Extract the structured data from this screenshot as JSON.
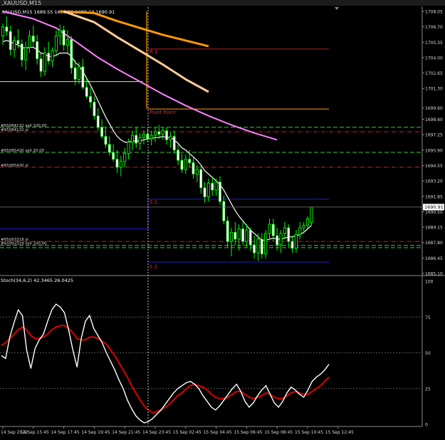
{
  "window": {
    "title_bar": ",XAUUSD,M15",
    "info_line": "XAUUSD,M15  1689.55 1690.91 1689.23 1690.91"
  },
  "colors": {
    "bull": "#00ff00",
    "bull_hollow_fill": "#000000",
    "bear_body": "#ffffff",
    "ma_fast": "#ffffff",
    "ma_mid": "#ff80ff",
    "ma_slow": "#ffcc99",
    "ma_slowest": "#ff9900",
    "pivot": "#ff9900",
    "resistance": "#b22222",
    "support": "#1e1ecc",
    "stoch_main": "#ffffff",
    "stoch_signal": "#dd0000",
    "grid": "#707070"
  },
  "main_chart": {
    "price_axis": {
      "min": 1685.1,
      "max": 1708.05,
      "ticks": [
        "1708.05",
        "1706.70",
        "1705.35",
        "1704.00",
        "1702.65",
        "1701.30",
        "1699.60",
        "1698.60",
        "1697.25",
        "1695.90",
        "1694.55",
        "1693.20",
        "1691.85",
        "1690.50",
        "1689.15",
        "1687.80",
        "1686.45",
        "1685.10"
      ],
      "current_price_label": "1690.91",
      "current_price": 1690.91
    },
    "levels": {
      "r1": {
        "label": "R 1",
        "price": 1704.75
      },
      "pivot": {
        "label": "Pivot Point",
        "price": 1699.5
      },
      "s1": {
        "label": "S 1",
        "price": 1691.6
      },
      "s2": {
        "label": "S 2",
        "price": 1686.1
      },
      "prev_pivot_yellow": {
        "price": 1701.9
      },
      "prev_s1_blue": {
        "price": 1689.0
      }
    },
    "order_lines": [
      {
        "label": "#65084132 sell 100.00",
        "price": 1697.9,
        "color": "#33cc33",
        "style": "dash"
      },
      {
        "label": "#65084132 sl",
        "price": 1697.5,
        "color": "#cc2222",
        "style": "dashdot"
      },
      {
        "label": "#65085430 sell 20.00",
        "price": 1695.7,
        "color": "#33cc33",
        "style": "dash"
      },
      {
        "label": "#65085430 sl",
        "price": 1694.4,
        "color": "#cc2222",
        "style": "dashdot"
      },
      {
        "label": "#65093318 sl",
        "price": 1687.9,
        "color": "#cc2222",
        "style": "dashdot"
      },
      {
        "label": "#65093318 sell 100.00",
        "price": 1687.55,
        "color": "#33cc33",
        "style": "dash"
      },
      {
        "label": "",
        "price": 1687.35,
        "color": "#33cc33",
        "style": "dash"
      }
    ],
    "ohlc": [
      [
        1705.9,
        1707.0,
        1705.1,
        1706.7
      ],
      [
        1706.7,
        1707.6,
        1705.9,
        1706.3
      ],
      [
        1706.3,
        1706.8,
        1704.2,
        1704.7
      ],
      [
        1704.7,
        1705.9,
        1704.0,
        1705.5
      ],
      [
        1705.5,
        1706.5,
        1704.8,
        1705.2
      ],
      [
        1705.2,
        1705.6,
        1703.2,
        1703.8
      ],
      [
        1703.8,
        1705.4,
        1702.9,
        1704.9
      ],
      [
        1704.9,
        1706.4,
        1704.4,
        1705.9
      ],
      [
        1705.9,
        1706.8,
        1704.9,
        1705.4
      ],
      [
        1705.4,
        1706.0,
        1703.4,
        1703.9
      ],
      [
        1703.9,
        1704.4,
        1702.3,
        1702.8
      ],
      [
        1702.8,
        1704.9,
        1702.4,
        1704.4
      ],
      [
        1704.4,
        1705.4,
        1703.4,
        1703.7
      ],
      [
        1703.7,
        1704.9,
        1703.2,
        1704.6
      ],
      [
        1704.6,
        1706.4,
        1704.1,
        1705.9
      ],
      [
        1705.9,
        1706.9,
        1705.1,
        1706.4
      ],
      [
        1706.4,
        1706.8,
        1704.6,
        1705.1
      ],
      [
        1705.1,
        1706.4,
        1704.4,
        1705.6
      ],
      [
        1705.6,
        1705.9,
        1702.6,
        1703.1
      ],
      [
        1703.1,
        1703.8,
        1701.6,
        1702.1
      ],
      [
        1702.1,
        1703.6,
        1701.7,
        1703.2
      ],
      [
        1703.2,
        1703.9,
        1701.2,
        1701.4
      ],
      [
        1701.4,
        1702.2,
        1700.4,
        1700.6
      ],
      [
        1700.6,
        1701.4,
        1699.6,
        1700.1
      ],
      [
        1700.1,
        1700.6,
        1698.6,
        1698.9
      ],
      [
        1698.9,
        1699.6,
        1697.6,
        1697.9
      ],
      [
        1697.9,
        1698.6,
        1696.9,
        1697.1
      ],
      [
        1697.1,
        1697.9,
        1696.1,
        1696.4
      ],
      [
        1696.4,
        1697.1,
        1695.4,
        1695.7
      ],
      [
        1695.7,
        1696.4,
        1694.9,
        1695.1
      ],
      [
        1695.1,
        1695.9,
        1693.9,
        1694.4
      ],
      [
        1694.4,
        1695.4,
        1693.6,
        1694.9
      ],
      [
        1694.9,
        1696.1,
        1694.4,
        1695.6
      ],
      [
        1695.6,
        1696.9,
        1695.1,
        1696.6
      ],
      [
        1696.6,
        1697.6,
        1695.9,
        1697.2
      ],
      [
        1697.2,
        1697.9,
        1696.1,
        1696.5
      ],
      [
        1696.5,
        1697.4,
        1695.9,
        1697.0
      ],
      [
        1697.0,
        1697.6,
        1696.4,
        1697.3
      ],
      [
        1697.3,
        1697.8,
        1696.6,
        1696.9
      ],
      [
        1696.9,
        1697.6,
        1696.3,
        1697.2
      ],
      [
        1697.2,
        1697.9,
        1696.6,
        1697.5
      ],
      [
        1697.5,
        1698.1,
        1696.9,
        1697.3
      ],
      [
        1697.3,
        1697.9,
        1696.8,
        1697.6
      ],
      [
        1697.6,
        1697.9,
        1696.4,
        1696.8
      ],
      [
        1696.8,
        1697.5,
        1696.1,
        1697.1
      ],
      [
        1697.1,
        1697.6,
        1695.6,
        1695.9
      ],
      [
        1695.9,
        1696.4,
        1694.6,
        1695.0
      ],
      [
        1695.0,
        1695.6,
        1693.9,
        1694.2
      ],
      [
        1694.2,
        1695.5,
        1693.8,
        1695.1
      ],
      [
        1695.1,
        1695.9,
        1694.4,
        1694.8
      ],
      [
        1694.8,
        1695.3,
        1693.4,
        1693.8
      ],
      [
        1693.8,
        1694.6,
        1693.1,
        1694.2
      ],
      [
        1694.2,
        1694.6,
        1692.1,
        1692.6
      ],
      [
        1692.6,
        1693.1,
        1691.3,
        1691.8
      ],
      [
        1691.8,
        1693.4,
        1691.4,
        1693.0
      ],
      [
        1693.0,
        1693.6,
        1691.9,
        1692.4
      ],
      [
        1692.4,
        1693.4,
        1691.9,
        1693.1
      ],
      [
        1693.1,
        1693.6,
        1691.1,
        1691.4
      ],
      [
        1691.4,
        1691.9,
        1689.4,
        1689.7
      ],
      [
        1689.7,
        1690.1,
        1687.4,
        1687.9
      ],
      [
        1687.9,
        1689.1,
        1686.6,
        1688.7
      ],
      [
        1688.7,
        1689.6,
        1687.6,
        1688.1
      ],
      [
        1688.1,
        1689.4,
        1687.1,
        1689.0
      ],
      [
        1689.0,
        1689.6,
        1687.6,
        1687.9
      ],
      [
        1687.9,
        1689.4,
        1687.4,
        1688.9
      ],
      [
        1688.9,
        1689.1,
        1687.1,
        1687.6
      ],
      [
        1687.6,
        1688.4,
        1686.4,
        1686.9
      ],
      [
        1686.9,
        1688.6,
        1686.2,
        1688.1
      ],
      [
        1688.1,
        1688.6,
        1686.4,
        1686.8
      ],
      [
        1686.8,
        1688.9,
        1686.4,
        1688.6
      ],
      [
        1688.6,
        1689.9,
        1688.1,
        1689.4
      ],
      [
        1689.4,
        1689.9,
        1687.9,
        1688.4
      ],
      [
        1688.4,
        1689.1,
        1687.1,
        1687.6
      ],
      [
        1687.6,
        1688.9,
        1686.9,
        1688.6
      ],
      [
        1688.6,
        1689.6,
        1688.1,
        1689.1
      ],
      [
        1689.1,
        1689.4,
        1687.4,
        1687.9
      ],
      [
        1687.9,
        1688.4,
        1686.9,
        1687.3
      ],
      [
        1687.3,
        1688.9,
        1686.9,
        1688.5
      ],
      [
        1688.5,
        1689.6,
        1688.1,
        1689.1
      ],
      [
        1689.1,
        1689.6,
        1688.6,
        1689.3
      ],
      [
        1689.3,
        1690.1,
        1688.9,
        1689.9
      ],
      [
        1689.55,
        1690.91,
        1689.23,
        1690.91
      ]
    ],
    "ma_fast": [
      1705.4,
      1705.5,
      1705.4,
      1705.2,
      1705.1,
      1704.9,
      1704.8,
      1704.9,
      1704.9,
      1704.7,
      1704.4,
      1704.3,
      1704.1,
      1704.1,
      1704.2,
      1704.4,
      1704.4,
      1704.4,
      1704.1,
      1703.6,
      1703.3,
      1702.8,
      1702.2,
      1701.6,
      1700.9,
      1700.2,
      1699.5,
      1698.8,
      1698.2,
      1697.6,
      1697.1,
      1696.8,
      1696.6,
      1696.6,
      1696.7,
      1696.7,
      1696.7,
      1696.8,
      1696.9,
      1696.9,
      1697.0,
      1697.0,
      1697.1,
      1697.0,
      1697.0,
      1696.8,
      1696.5,
      1696.1,
      1695.9,
      1695.6,
      1695.3,
      1695.0,
      1694.6,
      1694.1,
      1693.8,
      1693.5,
      1693.2,
      1692.9,
      1692.4,
      1691.8,
      1691.2,
      1690.6,
      1690.1,
      1689.7,
      1689.3,
      1688.9,
      1688.6,
      1688.3,
      1688.0,
      1688.0,
      1688.1,
      1688.2,
      1688.1,
      1688.1,
      1688.2,
      1688.3,
      1688.3,
      1688.4,
      1688.5,
      1688.7,
      1689.0,
      1689.3
    ],
    "ma_mid_line": [
      [
        0,
        1708.05
      ],
      [
        8,
        1707.4
      ],
      [
        14,
        1706.6
      ],
      [
        20,
        1705.2
      ],
      [
        25,
        1704.0
      ],
      [
        30,
        1703.0
      ],
      [
        36,
        1701.9
      ],
      [
        42,
        1700.8
      ],
      [
        48,
        1699.8
      ],
      [
        54,
        1698.9
      ],
      [
        60,
        1698.1
      ],
      [
        66,
        1697.4
      ],
      [
        72,
        1696.8
      ]
    ],
    "ma_slow_line": [
      [
        16,
        1708.05
      ],
      [
        24,
        1707.1
      ],
      [
        30,
        1705.8
      ],
      [
        36,
        1704.6
      ],
      [
        42,
        1703.4
      ],
      [
        48,
        1702.1
      ],
      [
        54,
        1701.0
      ]
    ],
    "ma_slowest_line": [
      [
        15,
        1708.05
      ],
      [
        24,
        1707.9
      ],
      [
        30,
        1707.2
      ],
      [
        36,
        1706.6
      ],
      [
        42,
        1706.0
      ],
      [
        48,
        1705.5
      ],
      [
        54,
        1705.0
      ]
    ]
  },
  "oscillator": {
    "label": "Stoch(34,6,2) 42.3465 26.0425",
    "ticks": [
      "100",
      "75",
      "50",
      "25",
      "0"
    ],
    "main": [
      48,
      46,
      61,
      71,
      80,
      76,
      52,
      39,
      53,
      59,
      63,
      72,
      80,
      84,
      82,
      78,
      66,
      52,
      40,
      60,
      72,
      76,
      67,
      62,
      57,
      50,
      44,
      38,
      31,
      25,
      17,
      11,
      6,
      3,
      1,
      2,
      4,
      7,
      10,
      14,
      18,
      22,
      25,
      27,
      29,
      30,
      28,
      25,
      20,
      16,
      12,
      10,
      13,
      17,
      21,
      25,
      28,
      23,
      16,
      12,
      15,
      20,
      24,
      27,
      21,
      15,
      12,
      16,
      22,
      26,
      24,
      21,
      19,
      24,
      30,
      33,
      35,
      38,
      42
    ],
    "signal": [
      55,
      57,
      60,
      63,
      66,
      68,
      66,
      62,
      60,
      60,
      61,
      63,
      66,
      68,
      69,
      69,
      67,
      64,
      60,
      59,
      59,
      61,
      61,
      60,
      58,
      56,
      52,
      48,
      43,
      38,
      33,
      27,
      22,
      17,
      13,
      10,
      8,
      9,
      10,
      12,
      14,
      17,
      20,
      22,
      25,
      27,
      28,
      27,
      26,
      24,
      21,
      19,
      18,
      18,
      19,
      21,
      23,
      23,
      21,
      19,
      18,
      19,
      20,
      22,
      21,
      19,
      18,
      18,
      20,
      22,
      23,
      22,
      21,
      21,
      23,
      25,
      27,
      30,
      33
    ]
  },
  "time_axis": {
    "labels": [
      {
        "text": "14 Sep 2022",
        "bar": 0
      },
      {
        "text": "14 Sep 15:45",
        "bar": 8
      },
      {
        "text": "14 Sep 17:45",
        "bar": 16
      },
      {
        "text": "14 Sep 19:45",
        "bar": 24
      },
      {
        "text": "14 Sep 21:45",
        "bar": 32
      },
      {
        "text": "14 Sep 23:45",
        "bar": 40
      },
      {
        "text": "15 Sep 02:45",
        "bar": 48
      },
      {
        "text": "15 Sep 04:45",
        "bar": 56
      },
      {
        "text": "15 Sep 06:45",
        "bar": 64
      },
      {
        "text": "15 Sep 08:45",
        "bar": 72
      },
      {
        "text": "15 Sep 10:45",
        "bar": 80
      },
      {
        "text": "15 Sep 12:45",
        "bar": 88
      }
    ]
  }
}
